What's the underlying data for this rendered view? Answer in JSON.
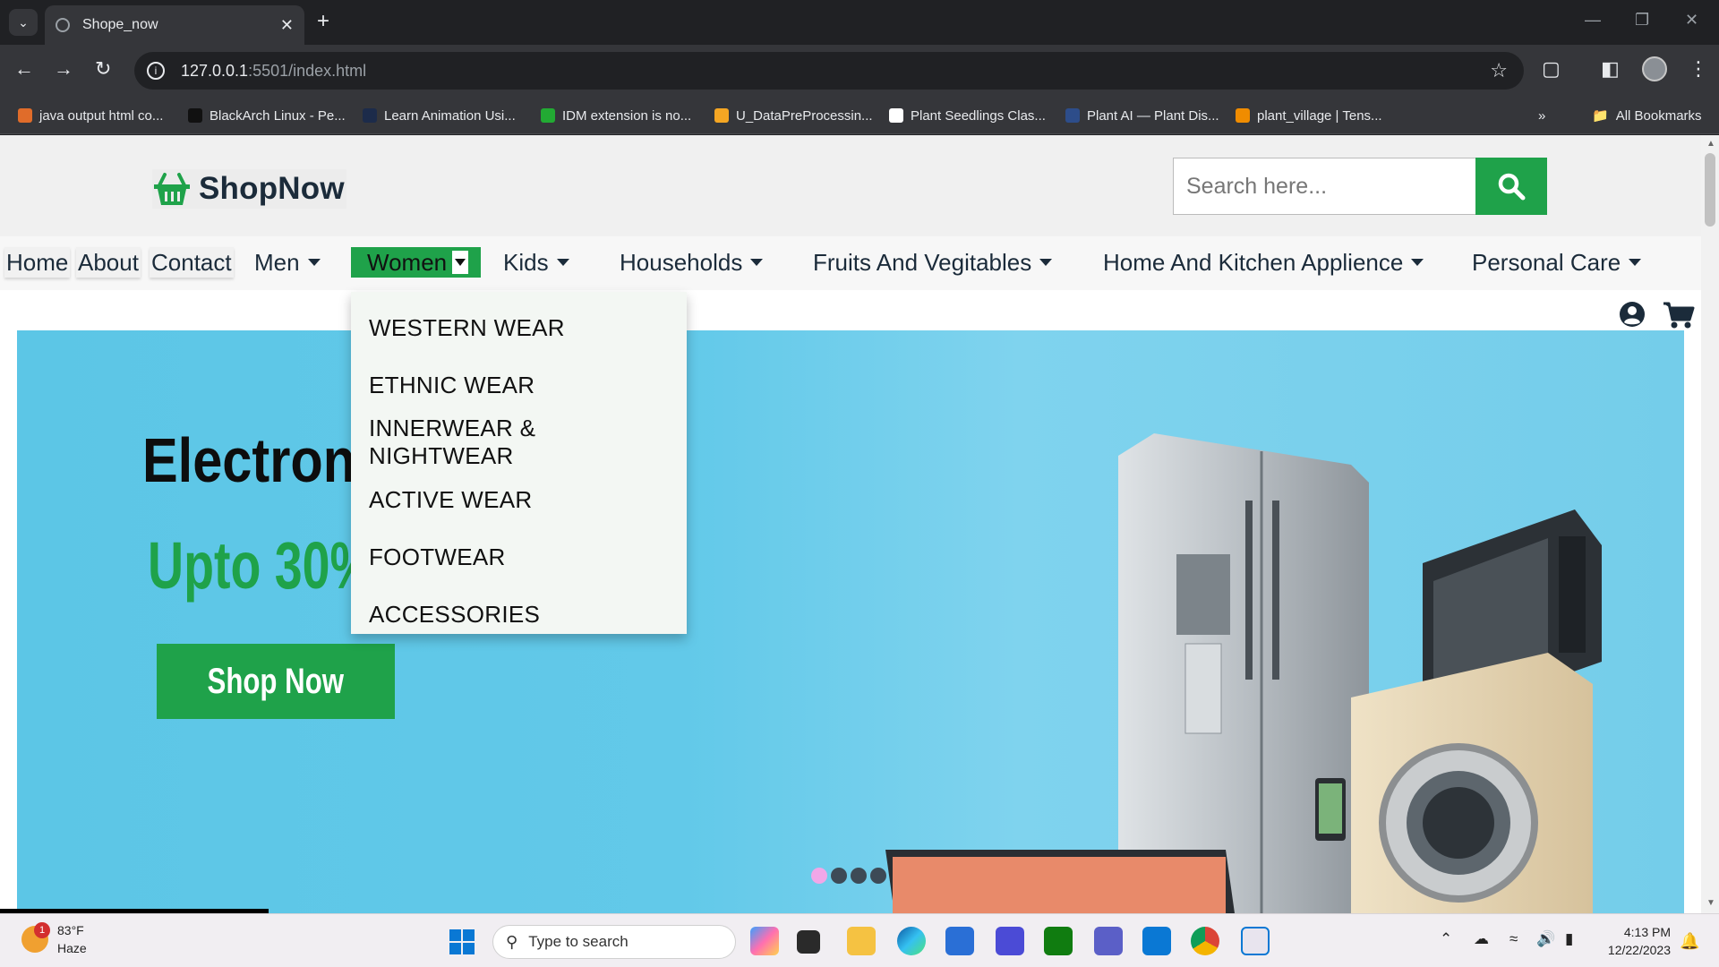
{
  "browser": {
    "tab_title": "Shope_now",
    "url_host": "127.0.0.1",
    "url_path": ":5501/index.html",
    "bookmarks": [
      {
        "label": "java output html co...",
        "color": "#e06c2a"
      },
      {
        "label": "BlackArch Linux - Pe...",
        "color": "#111111"
      },
      {
        "label": "Learn Animation Usi...",
        "color": "#1c2b4a"
      },
      {
        "label": "IDM extension is no...",
        "color": "#22aa33"
      },
      {
        "label": "U_DataPreProcessin...",
        "color": "#f5a623"
      },
      {
        "label": "Plant Seedlings Clas...",
        "color": "#ffffff"
      },
      {
        "label": "Plant AI — Plant Dis...",
        "color": "#2d4d8a"
      },
      {
        "label": "plant_village  |  Tens...",
        "color": "#f08c00"
      }
    ],
    "all_bookmarks": "All Bookmarks"
  },
  "site": {
    "logo_text": "ShopNow",
    "search_placeholder": "Search here...",
    "menu": [
      {
        "label": "Home",
        "dropdown": false
      },
      {
        "label": "About",
        "dropdown": false
      },
      {
        "label": "Contact",
        "dropdown": false
      },
      {
        "label": "Men",
        "dropdown": true
      },
      {
        "label": "Women",
        "dropdown": true,
        "active": true
      },
      {
        "label": "Kids",
        "dropdown": true
      },
      {
        "label": "Households",
        "dropdown": true
      },
      {
        "label": "Fruits And Vegitables",
        "dropdown": true
      },
      {
        "label": "Home And Kitchen Applience",
        "dropdown": true
      },
      {
        "label": "Personal Care",
        "dropdown": true
      }
    ],
    "dropdown_items": [
      "WESTERN WEAR",
      "ETHNIC WEAR",
      "INNERWEAR & NIGHTWEAR",
      "ACTIVE WEAR",
      "FOOTWEAR",
      "ACCESSORIES"
    ],
    "hero": {
      "title": "Electroni",
      "subtitle": "Upto 30%",
      "button": "Shop Now",
      "slides": 4,
      "active_slide": 1
    },
    "colors": {
      "accent": "#1fa24a",
      "hero_bg": "#5cc6e6"
    }
  },
  "taskbar": {
    "weather_temp": "83°F",
    "weather_desc": "Haze",
    "weather_badge": "1",
    "search_placeholder": "Type to search",
    "time": "4:13 PM",
    "date": "12/22/2023"
  }
}
